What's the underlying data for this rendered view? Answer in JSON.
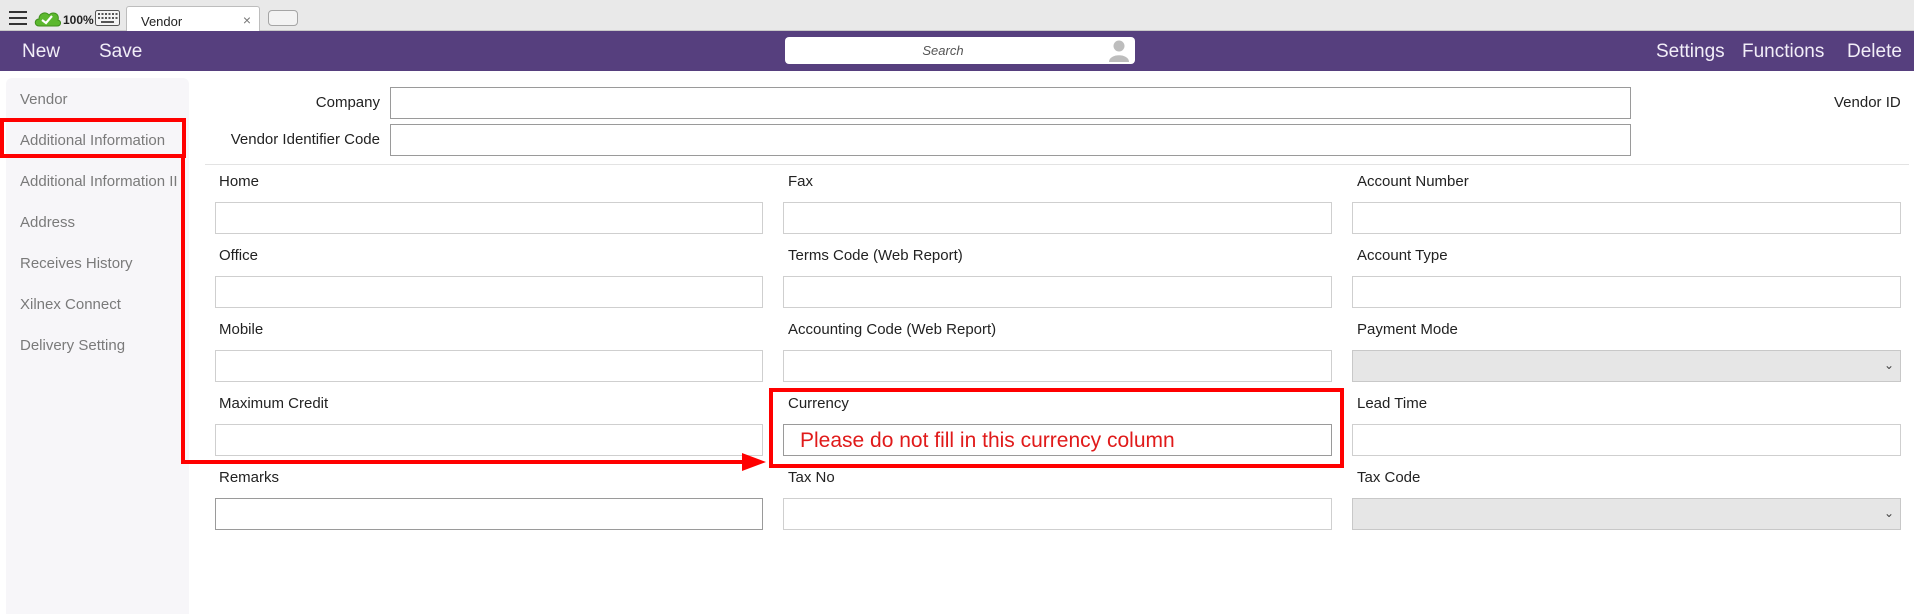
{
  "tabstrip": {
    "zoom": "100%",
    "tab_label": "Vendor",
    "tab_close": "×"
  },
  "toolbar": {
    "new": "New",
    "save": "Save",
    "search_placeholder": "Search",
    "settings": "Settings",
    "functions": "Functions",
    "delete": "Delete"
  },
  "sidebar": {
    "items": [
      {
        "label": "Vendor"
      },
      {
        "label": "Additional Information"
      },
      {
        "label": "Additional Information II"
      },
      {
        "label": "Address"
      },
      {
        "label": "Receives History"
      },
      {
        "label": "Xilnex Connect"
      },
      {
        "label": "Delivery Setting"
      }
    ]
  },
  "form": {
    "company": {
      "label": "Company",
      "value": ""
    },
    "vendor_identifier_code": {
      "label": "Vendor Identifier Code",
      "value": ""
    },
    "vendor_id": {
      "label": "Vendor ID"
    },
    "home": {
      "label": "Home",
      "value": ""
    },
    "fax": {
      "label": "Fax",
      "value": ""
    },
    "account_number": {
      "label": "Account Number",
      "value": ""
    },
    "office": {
      "label": "Office",
      "value": ""
    },
    "terms_code": {
      "label": "Terms Code (Web Report)",
      "value": ""
    },
    "account_type": {
      "label": "Account Type",
      "value": ""
    },
    "mobile": {
      "label": "Mobile",
      "value": ""
    },
    "accounting_code": {
      "label": "Accounting Code (Web Report)",
      "value": ""
    },
    "payment_mode": {
      "label": "Payment Mode",
      "value": ""
    },
    "maximum_credit": {
      "label": "Maximum Credit",
      "value": ""
    },
    "currency": {
      "label": "Currency",
      "value": ""
    },
    "lead_time": {
      "label": "Lead Time",
      "value": ""
    },
    "remarks": {
      "label": "Remarks",
      "value": ""
    },
    "tax_no": {
      "label": "Tax No",
      "value": ""
    },
    "tax_code": {
      "label": "Tax Code",
      "value": ""
    }
  },
  "annotation": {
    "note": "Please do not fill in this currency column",
    "color": "#ff0000"
  },
  "colors": {
    "toolbar": "#563f7e",
    "sidebar_bg": "#f7f6f9"
  }
}
